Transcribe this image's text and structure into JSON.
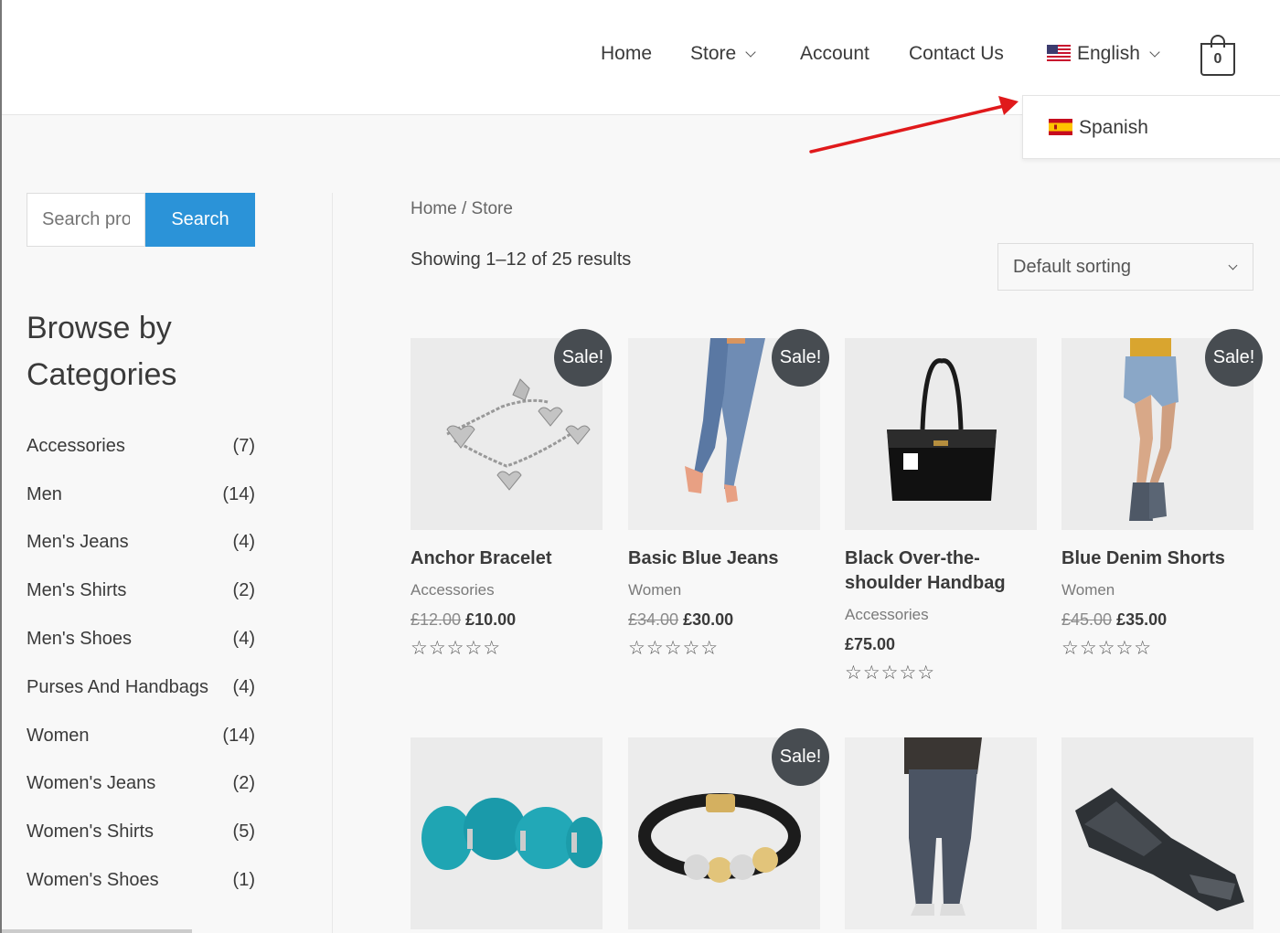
{
  "header": {
    "nav": [
      "Home",
      "Store",
      "Account",
      "Contact Us"
    ],
    "language": "English",
    "cart_count": "0"
  },
  "language_dropdown": {
    "options": [
      "Spanish"
    ]
  },
  "sidebar": {
    "search_placeholder": "Search products…",
    "search_button": "Search",
    "heading": "Browse by Categories",
    "categories": [
      {
        "name": "Accessories",
        "count": "(7)"
      },
      {
        "name": "Men",
        "count": "(14)"
      },
      {
        "name": "Men's Jeans",
        "count": "(4)"
      },
      {
        "name": "Men's Shirts",
        "count": "(2)"
      },
      {
        "name": "Men's Shoes",
        "count": "(4)"
      },
      {
        "name": "Purses And Handbags",
        "count": "(4)"
      },
      {
        "name": "Women",
        "count": "(14)"
      },
      {
        "name": "Women's Jeans",
        "count": "(2)"
      },
      {
        "name": "Women's Shirts",
        "count": "(5)"
      },
      {
        "name": "Women's Shoes",
        "count": "(1)"
      }
    ]
  },
  "main": {
    "breadcrumb": [
      "Home",
      "Store"
    ],
    "breadcrumb_separator": "/",
    "result_count": "Showing 1–12 of 25 results",
    "sorting": "Default sorting",
    "sale_label": "Sale!",
    "rating_stars": "☆☆☆☆☆",
    "products": [
      {
        "title": "Anchor Bracelet",
        "category": "Accessories",
        "old_price": "£12.00",
        "price": "£10.00",
        "sale": true,
        "image": "bracelet-charms"
      },
      {
        "title": "Basic Blue Jeans",
        "category": "Women",
        "old_price": "£34.00",
        "price": "£30.00",
        "sale": true,
        "image": "womens-jeans"
      },
      {
        "title": "Black Over-the-shoulder Handbag",
        "category": "Accessories",
        "old_price": "",
        "price": "£75.00",
        "sale": false,
        "image": "black-handbag"
      },
      {
        "title": "Blue Denim Shorts",
        "category": "Women",
        "old_price": "£45.00",
        "price": "£35.00",
        "sale": true,
        "image": "denim-shorts"
      }
    ],
    "products_row2": [
      {
        "sale": false,
        "image": "turquoise-bracelet"
      },
      {
        "sale": true,
        "image": "leather-bracelet"
      },
      {
        "sale": false,
        "image": "mens-jeans"
      },
      {
        "sale": false,
        "image": "folded-jeans"
      }
    ]
  },
  "colors": {
    "accent": "#2b93d8",
    "sale_badge": "#474c51",
    "annotation_arrow": "#e0191b"
  }
}
